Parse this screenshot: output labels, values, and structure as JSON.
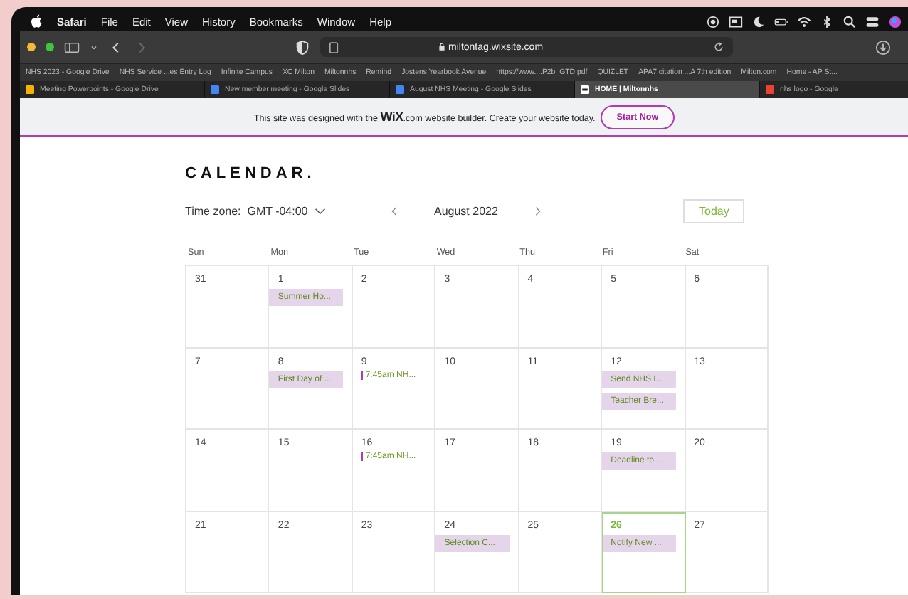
{
  "menu_bar": {
    "app": "Safari",
    "items": [
      "File",
      "Edit",
      "View",
      "History",
      "Bookmarks",
      "Window",
      "Help"
    ]
  },
  "address_bar": {
    "url": "miltontag.wixsite.com"
  },
  "bookmarks": [
    "NHS 2023 - Google Drive",
    "NHS Service ...es Entry Log",
    "Infinite Campus",
    "XC Milton",
    "Miltonnhs",
    "Remind",
    "Jostens Yearbook Avenue",
    "https://www....P2b_GTD.pdf",
    "QUIZLET",
    "APA7 citation ...A 7th edition",
    "Milton.com",
    "Home - AP St..."
  ],
  "tabs": [
    {
      "label": "Meeting Powerpoints - Google Drive",
      "kind": "drive",
      "selected": false
    },
    {
      "label": "New member meeting - Google Slides",
      "kind": "slides",
      "selected": false
    },
    {
      "label": "August NHS Meeting - Google Slides",
      "kind": "slides",
      "selected": false
    },
    {
      "label": "HOME | Miltonnhs",
      "kind": "wix",
      "selected": true
    },
    {
      "label": "nhs logo - Google",
      "kind": "google",
      "selected": false
    }
  ],
  "banner": {
    "text_before": "This site was designed with the",
    "brand": "WiX",
    "brand_suffix": ".com",
    "text_after": "website builder. Create your website today.",
    "button": "Start Now"
  },
  "calendar": {
    "title": "CALENDAR.",
    "timezone_label": "Time zone:",
    "timezone": "GMT -04:00",
    "month": "August 2022",
    "today_button": "Today",
    "weekdays": [
      "Sun",
      "Mon",
      "Tue",
      "Wed",
      "Thu",
      "Fri",
      "Sat"
    ],
    "weeks": [
      [
        {
          "day": "31",
          "selected": false
        },
        {
          "day": "1",
          "selected": false,
          "events": [
            {
              "kind": "block",
              "title": "Summer Ho..."
            }
          ]
        },
        {
          "day": "2",
          "selected": false
        },
        {
          "day": "3",
          "selected": false
        },
        {
          "day": "4",
          "selected": false
        },
        {
          "day": "5",
          "selected": false
        },
        {
          "day": "6",
          "selected": false
        }
      ],
      [
        {
          "day": "7",
          "selected": false
        },
        {
          "day": "8",
          "selected": false,
          "events": [
            {
              "kind": "block",
              "title": "First Day of ..."
            }
          ]
        },
        {
          "day": "9",
          "selected": false,
          "events": [
            {
              "kind": "timed",
              "title": "7:45am NH..."
            }
          ]
        },
        {
          "day": "10",
          "selected": false
        },
        {
          "day": "11",
          "selected": false
        },
        {
          "day": "12",
          "selected": false,
          "events": [
            {
              "kind": "block",
              "title": "Send NHS I..."
            },
            {
              "kind": "block",
              "title": "Teacher Bre..."
            }
          ]
        },
        {
          "day": "13",
          "selected": false
        }
      ],
      [
        {
          "day": "14",
          "selected": false
        },
        {
          "day": "15",
          "selected": false
        },
        {
          "day": "16",
          "selected": false,
          "events": [
            {
              "kind": "timed",
              "title": "7:45am NH..."
            }
          ]
        },
        {
          "day": "17",
          "selected": false
        },
        {
          "day": "18",
          "selected": false
        },
        {
          "day": "19",
          "selected": false,
          "events": [
            {
              "kind": "block",
              "title": "Deadline to ..."
            }
          ]
        },
        {
          "day": "20",
          "selected": false
        }
      ],
      [
        {
          "day": "21",
          "selected": false
        },
        {
          "day": "22",
          "selected": false
        },
        {
          "day": "23",
          "selected": false
        },
        {
          "day": "24",
          "selected": false,
          "events": [
            {
              "kind": "block",
              "title": "Selection C..."
            }
          ]
        },
        {
          "day": "25",
          "selected": false
        },
        {
          "day": "26",
          "selected": true,
          "events": [
            {
              "kind": "block",
              "title": "Notify New ..."
            }
          ]
        },
        {
          "day": "27",
          "selected": false
        }
      ]
    ]
  }
}
